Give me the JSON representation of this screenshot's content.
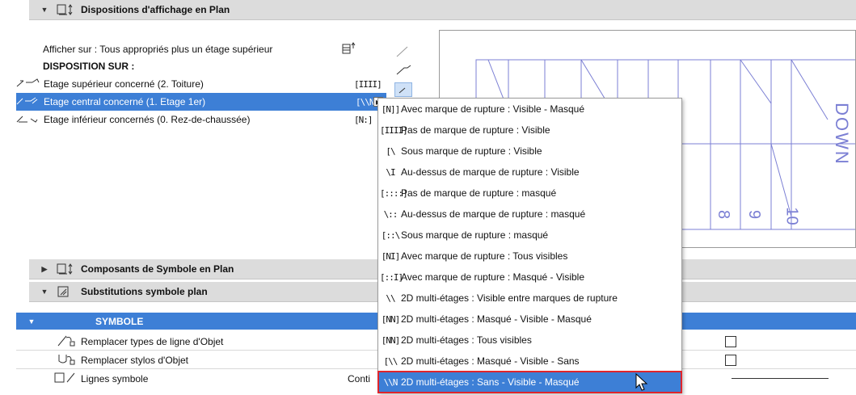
{
  "sections": {
    "plan_display": {
      "title": "Dispositions d'affichage en Plan"
    },
    "symbol_components": {
      "title": "Composants de Symbole en Plan"
    },
    "symbol_substitutions": {
      "title": "Substitutions symbole plan"
    }
  },
  "plan_display": {
    "show_on_label": "Afficher sur : Tous appropriés plus un étage supérieur",
    "show_on_icon": "stairs-floor-icon",
    "disposition_header": "DISPOSITION SUR :",
    "rows": [
      {
        "label": "Etage supérieur concerné (2. Toiture)",
        "symbol": "[IIII]",
        "icon": "upper-floor-stair-icon"
      },
      {
        "label": "Etage central concerné (1. Etage 1er)",
        "symbol": "[\\\\N]",
        "icon": "middle-floor-stair-icon",
        "selected": true
      },
      {
        "label": "Etage inférieur concernés (0. Rez-de-chaussée)",
        "symbol": "[N:]",
        "icon": "lower-floor-stair-icon"
      }
    ]
  },
  "preview": {
    "labels": [
      "8",
      "9",
      "10"
    ],
    "text": "DOWN"
  },
  "dropdown_menu": {
    "items": [
      {
        "symbol": "[N]]",
        "label": "Avec marque de rupture : Visible - Masqué"
      },
      {
        "symbol": "[IIII]",
        "label": "Pas de marque de rupture : Visible"
      },
      {
        "symbol": "[\\",
        "label": "Sous marque de rupture : Visible"
      },
      {
        "symbol": "\\I",
        "label": "Au-dessus de marque de rupture : Visible"
      },
      {
        "symbol": "[::::]",
        "label": "Pas de marque de rupture : masqué"
      },
      {
        "symbol": "\\::",
        "label": "Au-dessus de marque de rupture : masqué"
      },
      {
        "symbol": "[::\\",
        "label": "Sous marque de rupture : masqué"
      },
      {
        "symbol": "[NI]",
        "label": "Avec marque de rupture : Tous visibles"
      },
      {
        "symbol": "[::I]",
        "label": "Avec marque de rupture : Masqué - Visible"
      },
      {
        "symbol": "\\\\",
        "label": "2D multi-étages : Visible entre marques de rupture"
      },
      {
        "symbol": "[NN]",
        "label": "2D multi-étages : Masqué - Visible - Masqué"
      },
      {
        "symbol": "[NN]",
        "label": "2D multi-étages : Tous visibles"
      },
      {
        "symbol": "[\\\\",
        "label": "2D multi-étages : Masqué - Visible - Sans"
      },
      {
        "symbol": "\\\\N",
        "label": "2D multi-étages : Sans - Visible - Masqué",
        "highlighted": true
      }
    ]
  },
  "symbol_table": {
    "header": "SYMBOLE",
    "rows": [
      {
        "label": "Remplacer types de ligne d'Objet",
        "icon": "line-type-icon"
      },
      {
        "label": "Remplacer stylos d'Objet",
        "icon": "pen-icon"
      },
      {
        "label": "Lignes symbole",
        "icon": "symbol-lines-icon",
        "value": "Conti"
      }
    ]
  },
  "colors": {
    "selection": "#3d7fd6",
    "highlight_border": "#e0252b",
    "preview_lines": "#7b7fd4"
  }
}
